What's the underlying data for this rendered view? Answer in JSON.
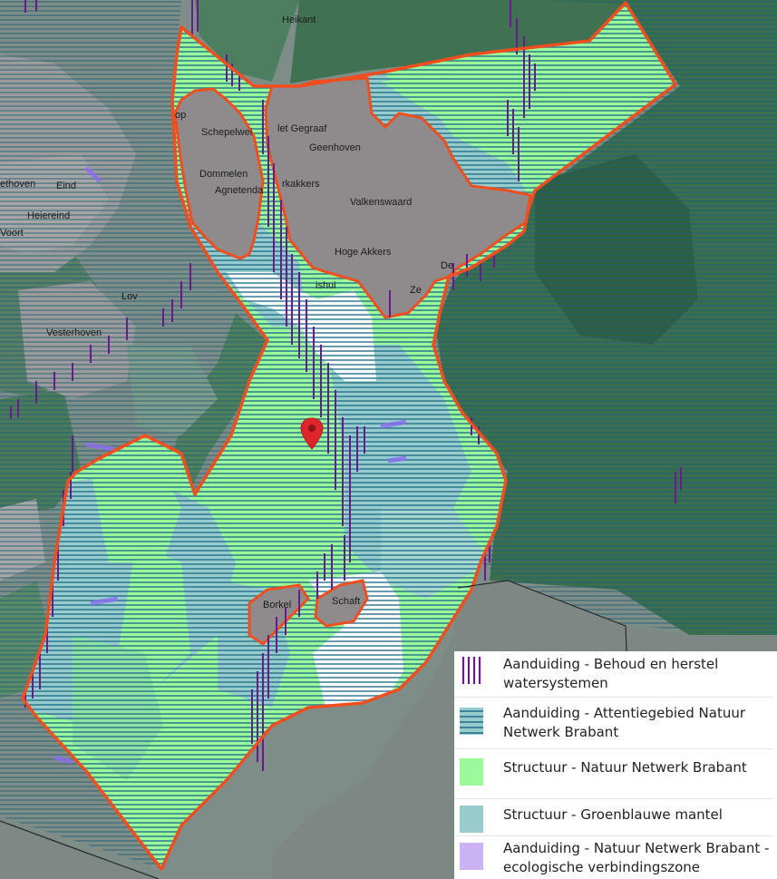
{
  "map": {
    "places": [
      {
        "id": "heikant",
        "label": "Heikant"
      },
      {
        "id": "schepelweijer",
        "label": "Schepelwei"
      },
      {
        "id": "top",
        "label": "op"
      },
      {
        "id": "dommelen",
        "label": "Dommelen"
      },
      {
        "id": "agnetendal",
        "label": "Agnetenda"
      },
      {
        "id": "het-gegraaf",
        "label": "let Gegraaf"
      },
      {
        "id": "geenhoven",
        "label": "Geenhoven"
      },
      {
        "id": "kerkakkers",
        "label": "rkakkers"
      },
      {
        "id": "valkenswaard",
        "label": "Valkenswaard"
      },
      {
        "id": "hoge-akkers",
        "label": "Hoge Akkers"
      },
      {
        "id": "dorp",
        "label": "De"
      },
      {
        "id": "zeelst",
        "label": "Ze"
      },
      {
        "id": "ishuis",
        "label": "ishui"
      },
      {
        "id": "eethoven",
        "label": "ethoven"
      },
      {
        "id": "eind",
        "label": "Eind"
      },
      {
        "id": "heiereind",
        "label": "Heiereind"
      },
      {
        "id": "voort",
        "label": "Voort"
      },
      {
        "id": "lo",
        "label": "Lov"
      },
      {
        "id": "westerhoven",
        "label": "Vesterhoven"
      },
      {
        "id": "borkel",
        "label": "Borkel"
      },
      {
        "id": "schaft",
        "label": "Schaft"
      }
    ],
    "marker": {
      "icon": "map-pin-icon",
      "color": "#e0242b"
    },
    "colors": {
      "boundary": "#f04e1f",
      "urban": "#8d8a8c",
      "forest_dark": "#3e6f52",
      "water_blue": "#98cccc",
      "nature_green": "#99fb99",
      "hatch": "#1f6d8a",
      "purple": "#6a1a8a"
    }
  },
  "legend": {
    "items": [
      {
        "label": "Aanduiding - Behoud en herstel watersystemen",
        "swatch": "vertical-purple-lines"
      },
      {
        "label": "Aanduiding - Attentiegebied Natuur Netwerk Brabant",
        "swatch": "horizontal-blue-lines"
      },
      {
        "label": "Structuur - Natuur Netwerk Brabant",
        "swatch": "green-fill"
      },
      {
        "label": "Structuur - Groenblauwe mantel",
        "swatch": "teal-fill"
      },
      {
        "label": "Aanduiding - Natuur Netwerk Brabant - ecologische verbindingszone",
        "swatch": "lavender-fill"
      }
    ],
    "colors": {
      "purple": "#6a1a8a",
      "blue_line": "#1f6d8a",
      "green": "#99fb99",
      "teal": "#98cccc",
      "lavender": "#c9b3f5"
    }
  }
}
